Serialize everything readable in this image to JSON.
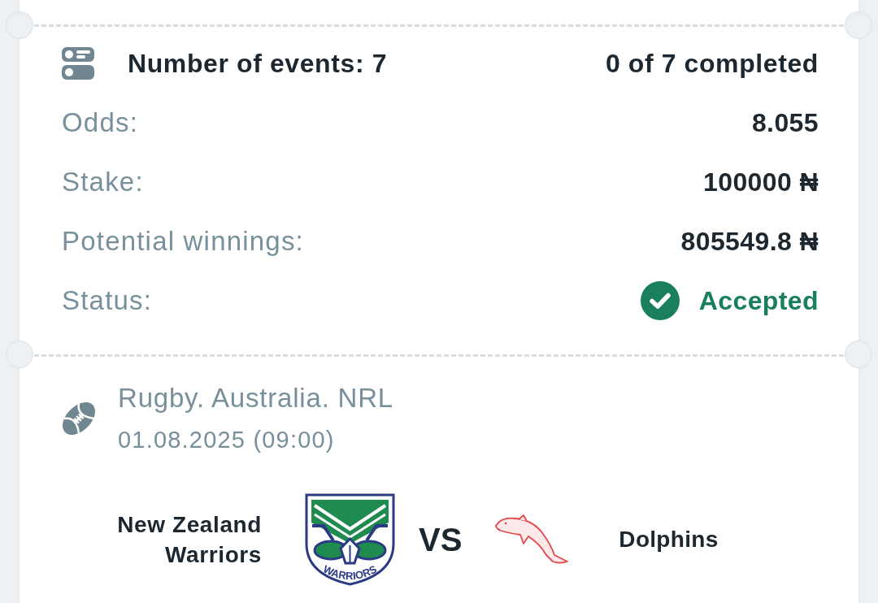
{
  "summary": {
    "title": "Number of events: 7",
    "progress": "0 of 7 completed",
    "rows": [
      {
        "kind": "value",
        "label": "Odds:",
        "value": "8.055"
      },
      {
        "kind": "value",
        "label": "Stake:",
        "value": "100000 ₦"
      },
      {
        "kind": "value",
        "label": "Potential winnings:",
        "value": "805549.8 ₦"
      },
      {
        "kind": "status",
        "label": "Status:",
        "value": "Accepted"
      }
    ]
  },
  "event": {
    "sport": "Rugby. Australia. NRL",
    "date": "01.08.2025 (09:00)",
    "home_team": {
      "name": "New Zealand Warriors",
      "logo_text": "WARRIORS"
    },
    "separator": "VS",
    "away_team": {
      "name": "Dolphins"
    }
  }
}
